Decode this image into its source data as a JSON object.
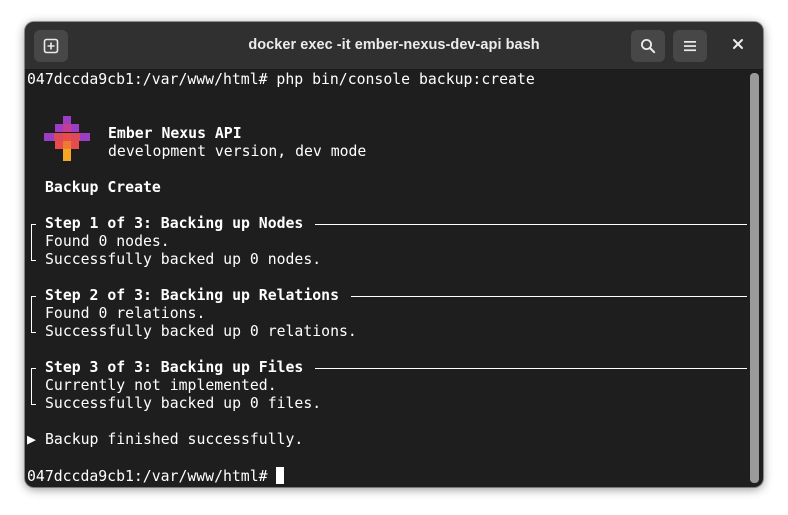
{
  "window": {
    "title": "docker exec -it ember-nexus-dev-api bash",
    "buttons": {
      "new_tab_icon": "new-tab-icon",
      "search_icon": "search-icon",
      "menu_icon": "hamburger-menu-icon",
      "close_icon": "close-icon"
    }
  },
  "colors": {
    "terminal_bg": "#1e1e1e",
    "titlebar_bg": "#303030",
    "text": "#ffffff",
    "logo_purple": "#9c3ec4",
    "logo_red": "#e94a4a",
    "logo_orange": "#f07a35",
    "logo_yellow": "#f5a623"
  },
  "terminal": {
    "command_line": "047dccda9cb1:/var/www/html# php bin/console backup:create",
    "app_name": "Ember Nexus API",
    "app_version": "development version, dev mode",
    "section_title": "Backup Create",
    "steps": [
      {
        "title": "Step 1 of 3: Backing up Nodes",
        "lines": [
          "Found 0 nodes.",
          "Successfully backed up 0 nodes."
        ]
      },
      {
        "title": "Step 2 of 3: Backing up Relations",
        "lines": [
          "Found 0 relations.",
          "Successfully backed up 0 relations."
        ]
      },
      {
        "title": "Step 3 of 3: Backing up Files",
        "lines": [
          "Currently not implemented.",
          "Successfully backed up 0 files."
        ]
      }
    ],
    "result_marker": "▶",
    "result_text": "Backup finished successfully.",
    "prompt": "047dccda9cb1:/var/www/html# "
  }
}
